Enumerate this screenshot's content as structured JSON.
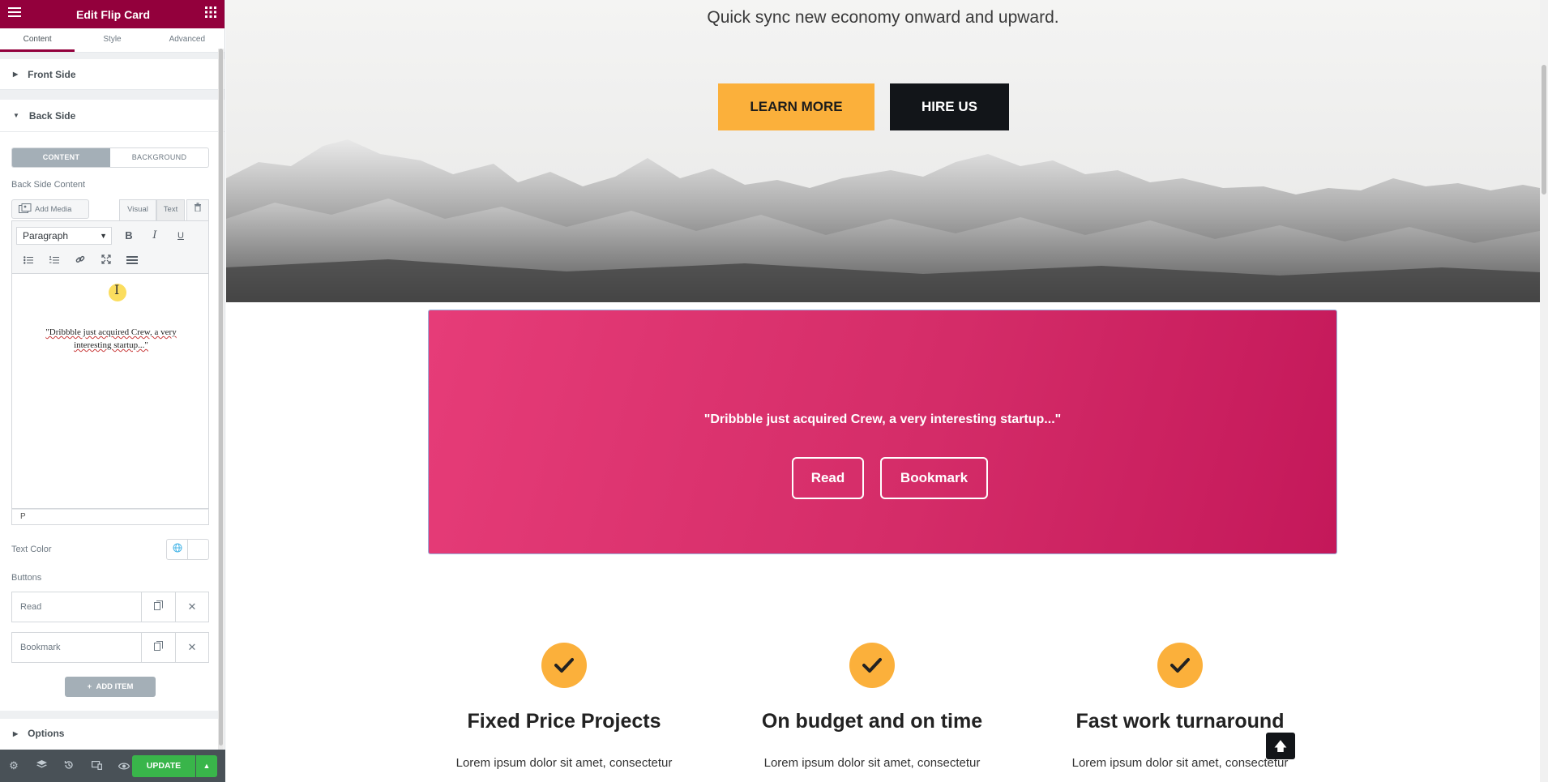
{
  "panel": {
    "title": "Edit Flip Card",
    "tabs": [
      "Content",
      "Style",
      "Advanced"
    ],
    "front_section": "Front Side",
    "back_section": "Back Side",
    "segment": {
      "content": "CONTENT",
      "background": "BACKGROUND"
    },
    "back_content_label": "Back Side Content",
    "add_media": "Add Media",
    "editor_tabs": {
      "visual": "Visual",
      "text": "Text"
    },
    "format_select": "Paragraph",
    "toolbar": {
      "bold": "B",
      "italic": "I",
      "underline": "U"
    },
    "editor_text": "\"Dribbble just acquired Crew, a very interesting startup...\"",
    "path": "P",
    "text_color_label": "Text Color",
    "buttons_label": "Buttons",
    "button_items": [
      "Read",
      "Bookmark"
    ],
    "add_item": "ADD ITEM",
    "options_section": "Options",
    "update": "UPDATE"
  },
  "hero": {
    "line1": "Quick sync new economy onward and upward.",
    "learn_more": "LEARN MORE",
    "hire_us": "HIRE US"
  },
  "flip_card": {
    "text": "\"Dribbble just acquired Crew, a very interesting startup...\"",
    "buttons": [
      "Read",
      "Bookmark"
    ]
  },
  "features": [
    {
      "title": "Fixed Price Projects",
      "text": "Lorem ipsum dolor sit amet, consectetur"
    },
    {
      "title": "On budget and on time",
      "text": "Lorem ipsum dolor sit amet, consectetur"
    },
    {
      "title": "Fast work turnaround",
      "text": "Lorem ipsum dolor sit amet, consectetur"
    }
  ],
  "colors": {
    "brand": "#93003c",
    "accent": "#fbb03b",
    "card": "#d42c68",
    "update": "#39b54a"
  },
  "icons": [
    "menu-icon",
    "grid-icon",
    "caret-right-icon",
    "caret-down-icon",
    "check-icon",
    "arrow-up-icon"
  ]
}
